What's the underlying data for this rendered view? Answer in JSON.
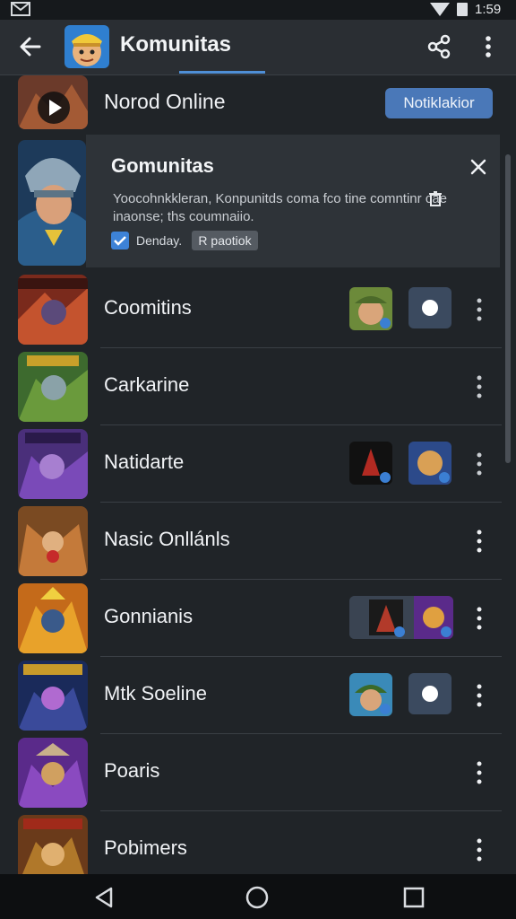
{
  "status": {
    "time": "1:59"
  },
  "app_bar": {
    "title": "Komunitas"
  },
  "first_row": {
    "label": "Norod Online",
    "button": "Notiklakior"
  },
  "panel": {
    "title": "Gomunitas",
    "description": "Yoocohnkkleran, Konpunitds coma fco tine comntinr cae inaonse; ths coumnaiio.",
    "checkbox_label": "Denday.",
    "tag": "R paotiok"
  },
  "rows": [
    {
      "label": "Coomitins"
    },
    {
      "label": "Carkarine"
    },
    {
      "label": "Natidarte"
    },
    {
      "label": "Nasic Onllánls"
    },
    {
      "label": "Gonnianis"
    },
    {
      "label": "Mtk Soeline"
    },
    {
      "label": "Poaris"
    },
    {
      "label": "Pobimers"
    }
  ],
  "icons": {
    "back": "arrow-left-icon",
    "share": "share-icon",
    "more": "more-vertical-icon",
    "close": "close-icon",
    "nav": [
      "back-triangle-icon",
      "home-circle-icon",
      "recents-square-icon"
    ]
  },
  "colors": {
    "accent": "#4a78b8",
    "checkbox": "#3d82d6",
    "background": "#202428"
  }
}
